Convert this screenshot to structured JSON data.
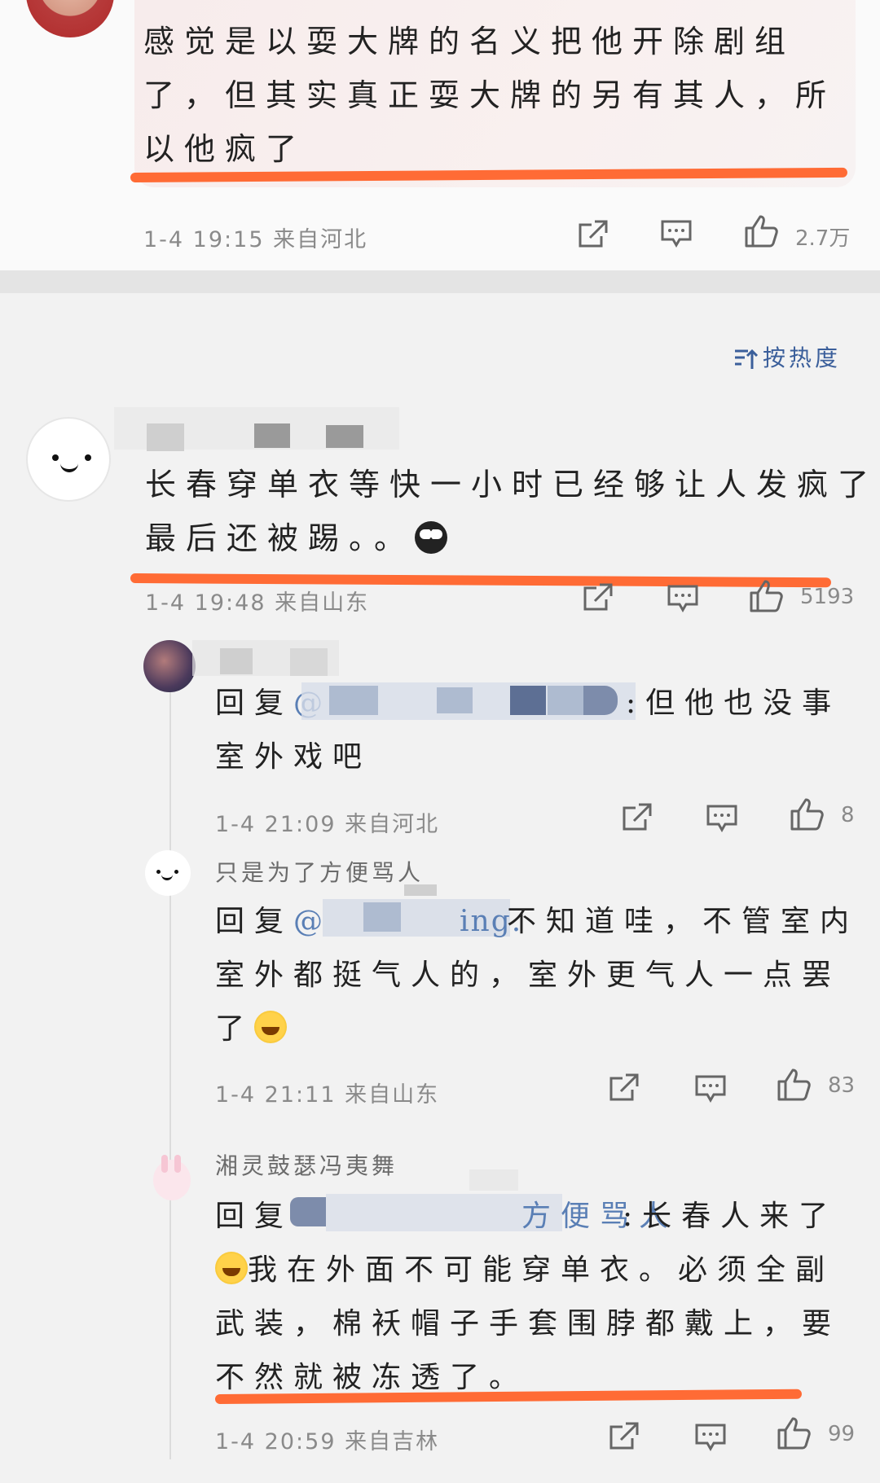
{
  "top_comment": {
    "text": "感觉是以耍大牌的名义把他开除剧组了，但其实真正耍大牌的另有其人，所以他疯了",
    "meta": "1-4 19:15 来自河北",
    "likes": "2.7万"
  },
  "sort": {
    "label": "按热度"
  },
  "comment_2": {
    "text_line1": "长春穿单衣等快一小时已经够让人发疯了",
    "text_line2": "最后还被踢。。",
    "meta": "1-4 19:48 来自山东",
    "likes": "5193"
  },
  "replies": [
    {
      "reply_prefix": "回复",
      "mention": "@",
      "text_after": ":但他也没事",
      "text_line2": "室外戏吧",
      "meta": "1-4 21:09 来自河北",
      "likes": "8"
    },
    {
      "username": "只是为了方便骂人",
      "reply_prefix": "回复",
      "mention": "@",
      "mention_tail": "ing.",
      "text_after": "不知道哇，不管室内",
      "text_line2": "室外都挺气人的，室外更气人一点罢",
      "text_line3": "了",
      "meta": "1-4 21:11 来自山东",
      "likes": "83"
    },
    {
      "username": "湘灵鼓瑟冯夷舞",
      "reply_prefix": "回复",
      "mention_tail": "方便骂人",
      "text_after": ":长春人来了",
      "text_line2": "我在外面不可能穿单衣。必须全副",
      "text_line3": "武装，棉袄帽子手套围脖都戴上，要",
      "text_line4": "不然就被冻透了。",
      "meta": "1-4 20:59 来自吉林",
      "likes": "99"
    }
  ],
  "colors": {
    "underline": "#ff6b35",
    "link": "#5a7fb5",
    "meta": "#8a8a8a"
  }
}
